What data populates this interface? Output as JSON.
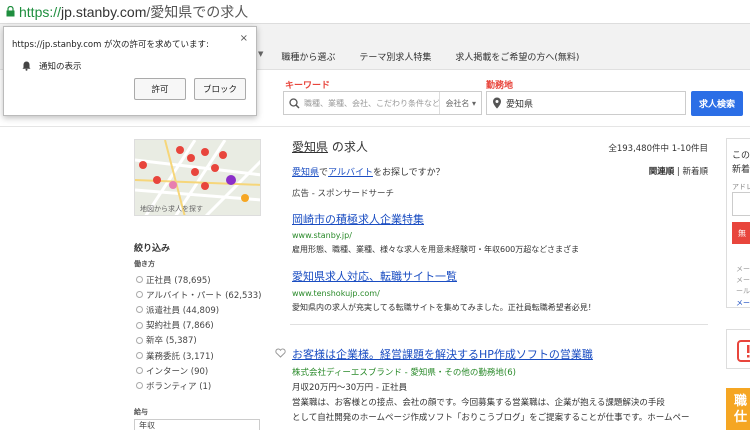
{
  "browser": {
    "url_scheme": "https://",
    "url_host": "jp.stanby.com",
    "url_path": "/愛知県での求人"
  },
  "popup": {
    "message": "https://jp.stanby.com が次の許可を求めています:",
    "close": "×",
    "permission": "通知の表示",
    "allow": "許可",
    "block": "ブロック"
  },
  "nav": {
    "links": [
      "職種から選ぶ",
      "テーマ別求人特集",
      "求人掲載をご希望の方へ(無料)"
    ]
  },
  "search": {
    "keyword_label": "キーワード",
    "keyword_placeholder": "職種、業種、会社、こだわり条件など",
    "keyword_select": "会社名",
    "location_label": "勤務地",
    "location_value": "愛知県",
    "button": "求人検索"
  },
  "sidebar": {
    "map_caption": "地図から求人を探す",
    "refine_title": "絞り込み",
    "employment_title": "働き方",
    "employment_items": [
      "正社員 (78,695)",
      "アルバイト・パート (62,533)",
      "派遣社員 (44,809)",
      "契約社員 (7,866)",
      "新卒 (5,387)",
      "業務委託 (3,171)",
      "インターン (90)",
      "ボランティア (1)"
    ],
    "salary_title": "給与",
    "salary_select": "年収"
  },
  "results": {
    "title_highlight": "愛知県",
    "title_rest": " の求人",
    "count": "全193,480件中 1-10件目",
    "related_link1": "愛知県",
    "related_mid": "で",
    "related_link2": "アルバイト",
    "related_rest": "をお探しですか？",
    "sort_relevance": "関連順",
    "sort_sep": " | ",
    "sort_new": "新着順",
    "ad_label": "広告 - スポンサードサーチ",
    "ads": [
      {
        "title": "岡崎市の積極求人企業特集",
        "url": "www.stanby.jp/",
        "desc": "雇用形態、職種、業種、様々な求人を用意未経験可・年収600万超などさまざま"
      },
      {
        "title": "愛知県求人対応、転職サイト一覧",
        "url": "www.tenshokujp.com/",
        "desc": "愛知県内の求人が充実してる転職サイトを集めてみました。正社員転職希望者必見！"
      }
    ],
    "job": {
      "title": "お客様は企業様。経営課題を解決するHP作成ソフトの営業職",
      "company": "株式会社ディーエスブランド - 愛知県・その他の勤務地(6)",
      "salary": "月収20万円～30万円 - 正社員",
      "desc1": "営業職は、お客様との接点、会社の顔です。今回募集する営業職は、企業が抱える課題解決の手段",
      "desc2": "として自社開発のホームページ作成ソフト「おりこうブログ」をご提案することが仕事です。ホームペー"
    }
  },
  "right_panel": {
    "t1": "この",
    "t2": "新着",
    "t3": "アドレ",
    "btn": "無",
    "lines": [
      "メー",
      "メー",
      "ール"
    ],
    "link": "メー",
    "orange": "職仕"
  },
  "colors": {
    "accent_red": "#e8453c",
    "link_blue": "#1a4dc2",
    "url_green": "#2a8a2a",
    "button_blue": "#2b6ee6"
  }
}
